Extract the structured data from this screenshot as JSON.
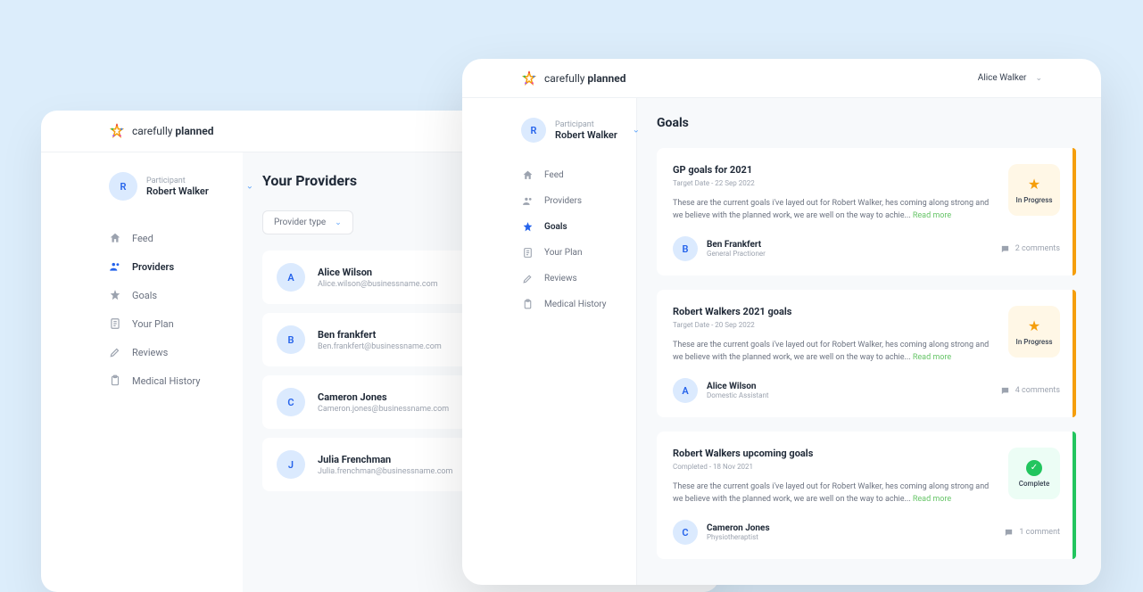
{
  "brand": {
    "light": "carefully",
    "bold": "planned"
  },
  "left": {
    "participant": {
      "initial": "R",
      "label": "Participant",
      "name": "Robert Walker"
    },
    "nav": {
      "feed": "Feed",
      "providers": "Providers",
      "goals": "Goals",
      "yourplan": "Your Plan",
      "reviews": "Reviews",
      "medical": "Medical History"
    },
    "title": "Your Providers",
    "filter": "Provider type",
    "providers": [
      {
        "initial": "A",
        "name": "Alice Wilson",
        "email": "Alice.wilson@businessname.com"
      },
      {
        "initial": "B",
        "name": "Ben frankfert",
        "email": "Ben.frankfert@businessname.com"
      },
      {
        "initial": "C",
        "name": "Cameron Jones",
        "email": "Cameron.jones@businessname.com"
      },
      {
        "initial": "J",
        "name": "Julia Frenchman",
        "email": "Julia.frenchman@businessname.com"
      }
    ]
  },
  "right": {
    "user": "Alice Walker",
    "participant": {
      "initial": "R",
      "label": "Participant",
      "name": "Robert Walker"
    },
    "nav": {
      "feed": "Feed",
      "providers": "Providers",
      "goals": "Goals",
      "yourplan": "Your Plan",
      "reviews": "Reviews",
      "medical": "Medical History"
    },
    "title": "Goals",
    "status": {
      "progress": "In Progress",
      "complete": "Complete"
    },
    "read_more": "Read more",
    "goals": [
      {
        "title": "GP goals for 2021",
        "date": "Target Date - 22 Sep 2022",
        "desc": "These are the current goals i've layed out for Robert Walker, hes coming along strong and we believe with the planned work, we are well on the way to achie... ",
        "author_initial": "B",
        "author_name": "Ben Frankfert",
        "author_role": "General Practioner",
        "comments": "2 comments",
        "status": "progress"
      },
      {
        "title": "Robert Walkers 2021 goals",
        "date": "Target Date - 20 Sep 2022",
        "desc": "These are the current goals i've layed out for Robert Walker, hes coming along strong and we believe with the planned work, we are well on the way to achie... ",
        "author_initial": "A",
        "author_name": "Alice Wilson",
        "author_role": "Domestic Assistant",
        "comments": "4 comments",
        "status": "progress"
      },
      {
        "title": "Robert Walkers upcoming goals",
        "date": "Completed - 18 Nov 2021",
        "desc": "These are the current goals i've layed out for Robert Walker, hes coming along strong and we believe with the planned work, we are well on the way to achie... ",
        "author_initial": "C",
        "author_name": "Cameron Jones",
        "author_role": "Physiotheraptist",
        "comments": "1 comment",
        "status": "complete"
      }
    ]
  }
}
